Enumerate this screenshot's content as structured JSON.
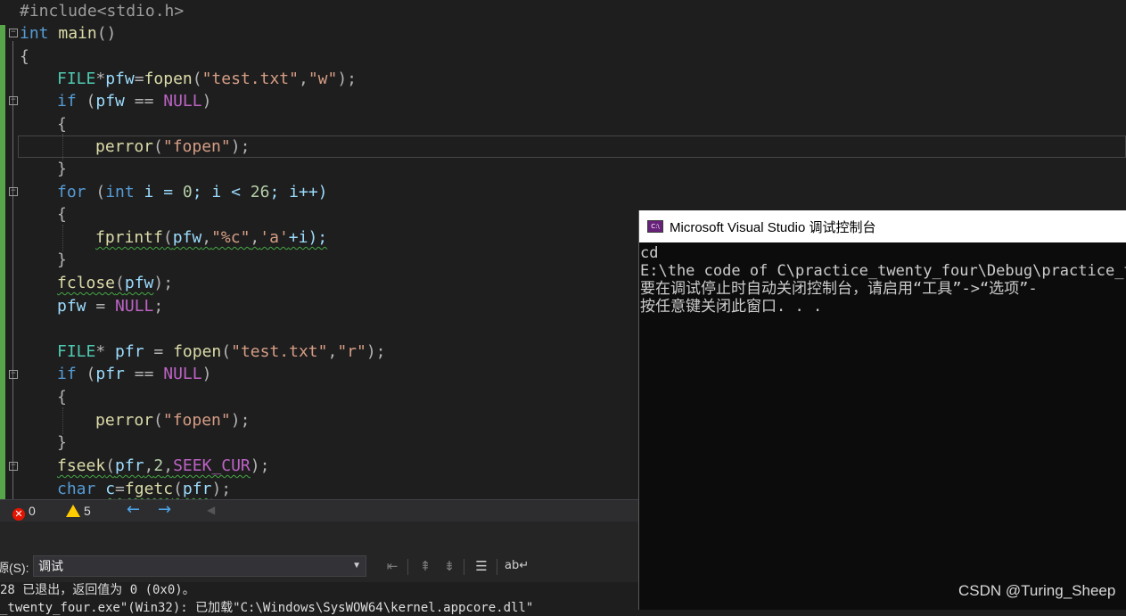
{
  "editor": {
    "lines": [
      [
        "#include<stdio.h>"
      ],
      [
        "int",
        " ",
        "main",
        "()"
      ],
      [
        "{"
      ],
      [
        "FILE",
        "*",
        "pfw",
        "=",
        "fopen",
        "(",
        "\"test.txt\"",
        ",",
        "\"w\"",
        ");"
      ],
      [
        "if",
        " (",
        "pfw",
        " == ",
        "NULL",
        ")"
      ],
      [
        "{"
      ],
      [
        "perror",
        "(",
        "\"fopen\"",
        ");"
      ],
      [
        "}"
      ],
      [
        "for",
        " (",
        "int",
        " i = ",
        "0",
        "; i < ",
        "26",
        "; i++)"
      ],
      [
        "{"
      ],
      [
        "fprintf",
        "(",
        "pfw",
        ",",
        "\"%c\"",
        ",",
        "'a'",
        "+i);"
      ],
      [
        "}"
      ],
      [
        "fclose",
        "(",
        "pfw",
        ");"
      ],
      [
        "pfw",
        " = ",
        "NULL",
        ";"
      ],
      [
        ""
      ],
      [
        "FILE",
        "* ",
        "pfr",
        " = ",
        "fopen",
        "(",
        "\"test.txt\"",
        ",",
        "\"r\"",
        ");"
      ],
      [
        "if",
        " (",
        "pfr",
        " == ",
        "NULL",
        ")"
      ],
      [
        "{"
      ],
      [
        "perror",
        "(",
        "\"fopen\"",
        ");"
      ],
      [
        "}"
      ],
      [
        "fseek",
        "(",
        "pfr",
        ",",
        "2",
        ",",
        "SEEK_CUR",
        ");"
      ],
      [
        "char",
        " ",
        "c",
        "=",
        "fgetc",
        "(",
        "pfr",
        ");"
      ]
    ]
  },
  "status": {
    "errors": "0",
    "warnings": "5",
    "back_icon": "arrow-left-icon",
    "forward_icon": "arrow-right-icon"
  },
  "output": {
    "source_label": "源(S):",
    "source_value": "调试",
    "line1": "28 已退出，返回值为 0 (0x0)。",
    "line2": "_twenty_four.exe\"(Win32): 已加载\"C:\\Windows\\SysWOW64\\kernel.appcore.dll\""
  },
  "console": {
    "title": "Microsoft Visual Studio 调试控制台",
    "icon_text": "C:\\",
    "lines": [
      "cd",
      "E:\\the code of C\\practice_twenty_four\\Debug\\practice_tw",
      "要在调试停止时自动关闭控制台，请启用“工具”->“选项”-",
      "按任意键关闭此窗口. . ."
    ]
  },
  "watermark": "CSDN @Turing_Sheep",
  "colors": {
    "editor_bg": "#1e1e1e",
    "keyword": "#569cd6",
    "function": "#dcdcaa",
    "string": "#d69d85",
    "macro": "#bd63c5",
    "change_bar": "#57a64a",
    "console_bg": "#0c0c0c"
  }
}
